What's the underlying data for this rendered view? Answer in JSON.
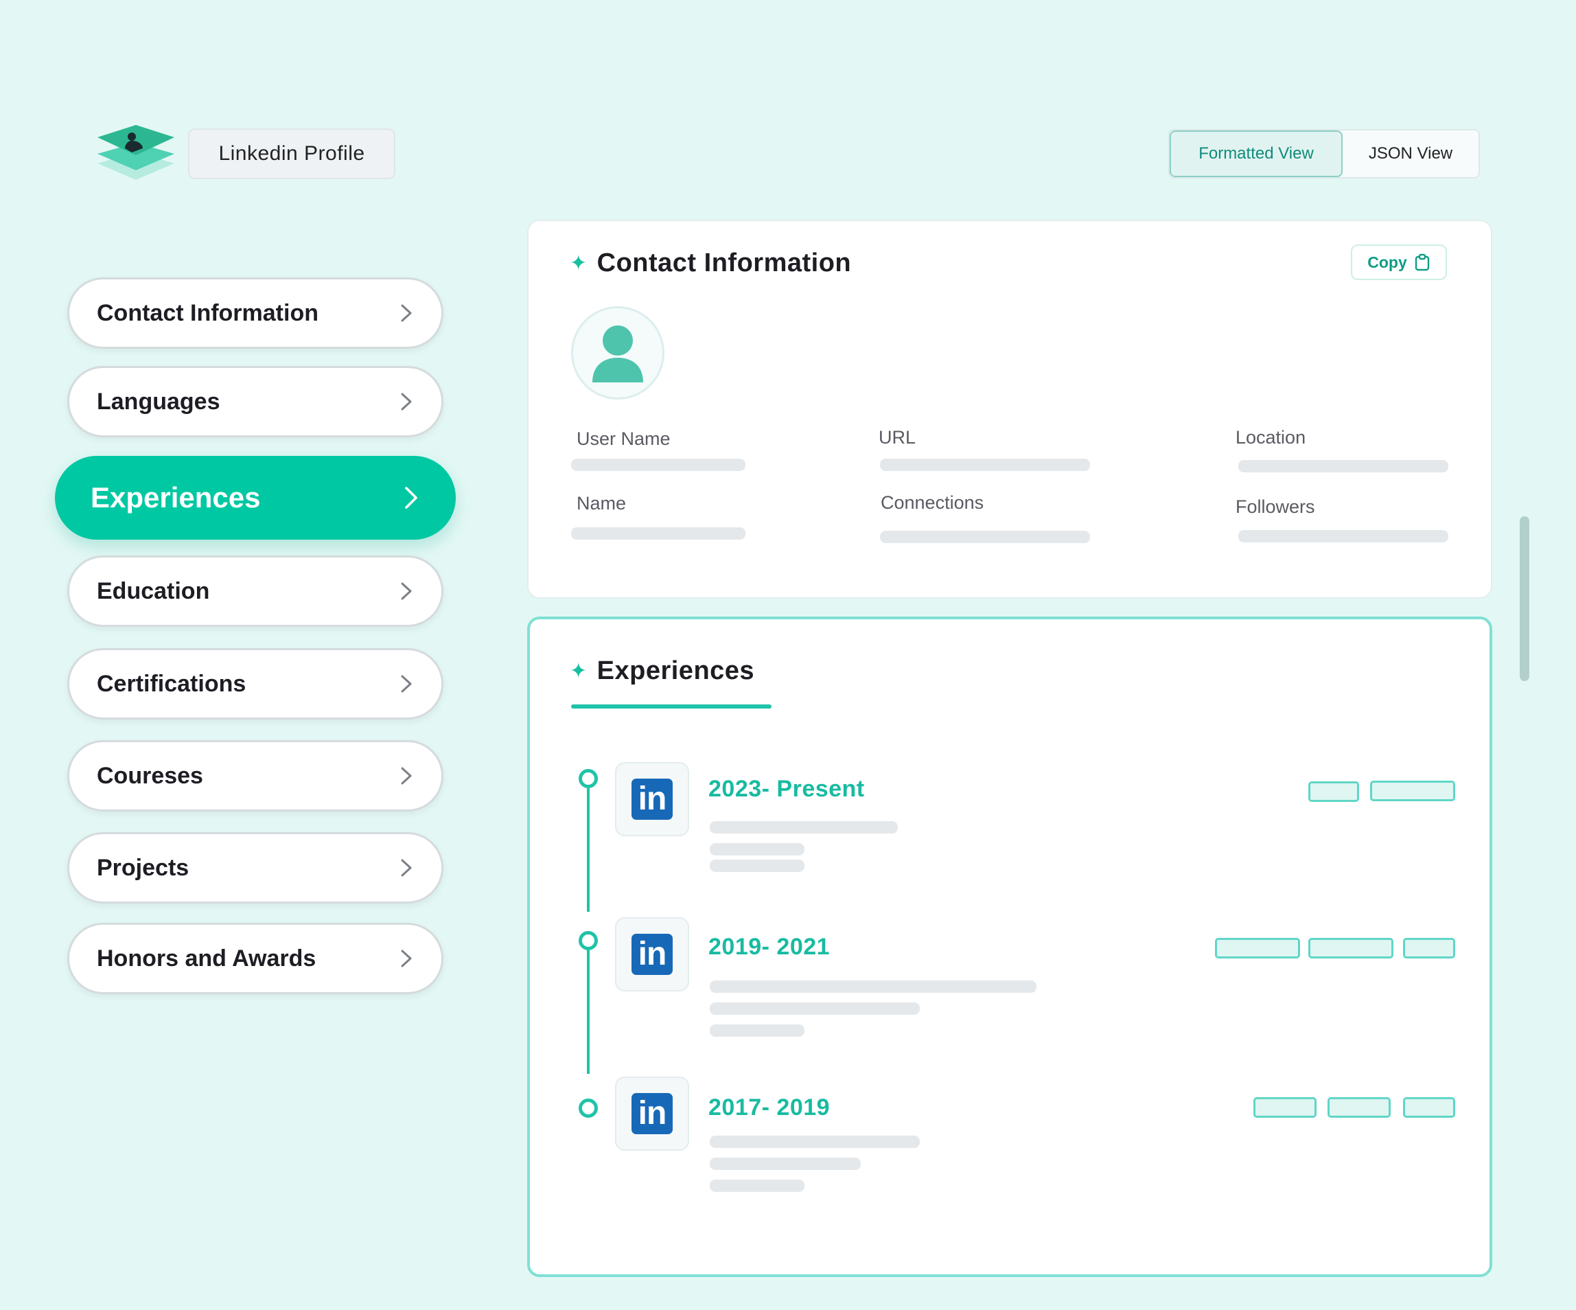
{
  "header": {
    "app_title": "Linkedin Profile",
    "views": [
      {
        "label": "Formatted View",
        "active": true
      },
      {
        "label": "JSON View",
        "active": false
      }
    ]
  },
  "sidebar": {
    "items": [
      {
        "label": "Contact Information",
        "active": false
      },
      {
        "label": "Languages",
        "active": false
      },
      {
        "label": "Experiences",
        "active": true
      },
      {
        "label": "Education",
        "active": false
      },
      {
        "label": "Certifications",
        "active": false
      },
      {
        "label": "Coureses",
        "active": false
      },
      {
        "label": "Projects",
        "active": false
      },
      {
        "label": "Honors and Awards",
        "active": false
      }
    ]
  },
  "contact": {
    "title": "Contact Information",
    "copy_label": "Copy",
    "fields": {
      "user_name": "User Name",
      "url": "URL",
      "location": "Location",
      "name": "Name",
      "connections": "Connections",
      "followers": "Followers"
    }
  },
  "experiences": {
    "title": "Experiences",
    "company_logo_text": "in",
    "items": [
      {
        "period": "2023- Present"
      },
      {
        "period": "2019- 2021"
      },
      {
        "period": "2017- 2019"
      }
    ]
  },
  "colors": {
    "accent": "#00c8a2",
    "accent_text": "#18bba1",
    "background": "#e3f8f5",
    "linkedin_blue": "#1769b7"
  },
  "icons": {
    "logo": "stacked-layers-profile-icon",
    "chevron": "chevron-right-icon",
    "copy": "clipboard-icon",
    "sparkle": "sparkle-icon",
    "avatar": "user-avatar-icon"
  }
}
